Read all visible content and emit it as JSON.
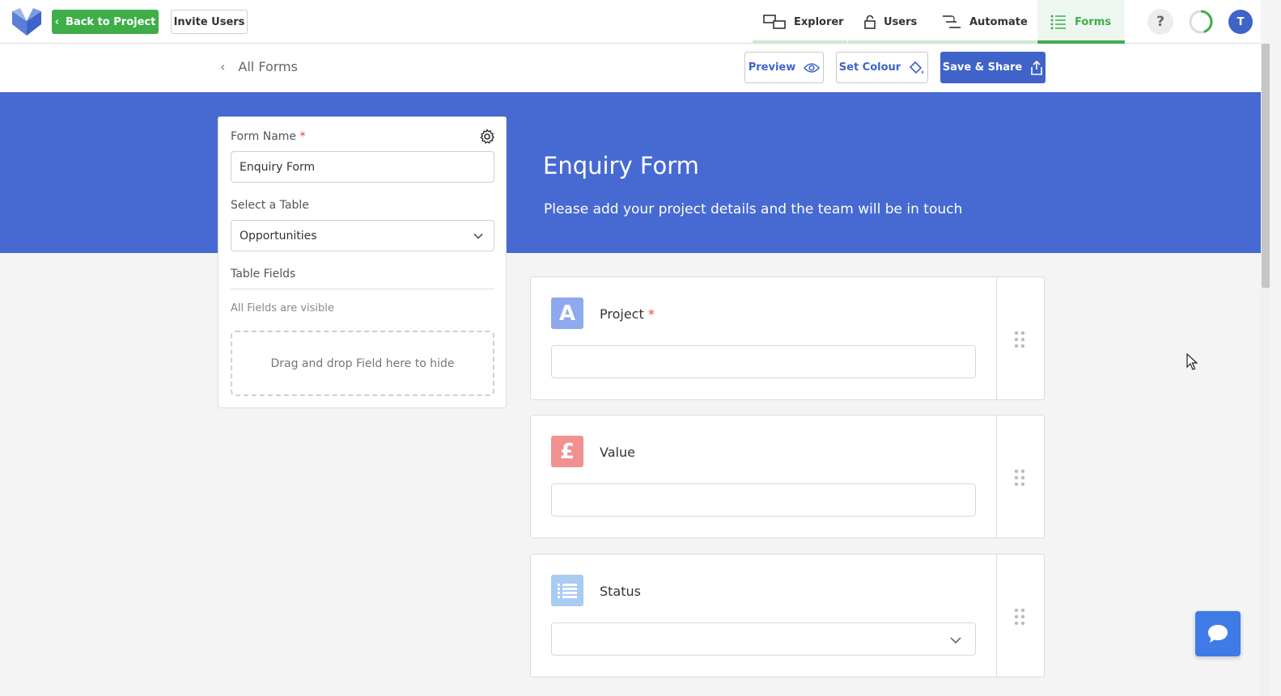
{
  "topnav": {
    "back_label": "Back to Project",
    "invite_label": "Invite Users",
    "tabs": [
      {
        "label": "Explorer",
        "icon": "explorer-icon"
      },
      {
        "label": "Users",
        "icon": "lock-icon"
      },
      {
        "label": "Automate",
        "icon": "automate-icon"
      },
      {
        "label": "Forms",
        "icon": "forms-icon",
        "active": true
      }
    ],
    "help_label": "?",
    "avatar_initial": "T"
  },
  "subheader": {
    "all_forms_label": "All Forms",
    "preview_label": "Preview",
    "set_colour_label": "Set Colour",
    "save_share_label": "Save & Share"
  },
  "banner": {
    "title": "Enquiry Form",
    "description": "Please add your project details and the team will be in touch",
    "color": "#476ad2"
  },
  "panel": {
    "form_name_label": "Form Name",
    "required_mark": "*",
    "form_name_value": "Enquiry Form",
    "select_table_label": "Select a Table",
    "select_table_value": "Opportunities",
    "table_fields_label": "Table Fields",
    "visible_note": "All Fields are visible",
    "dropzone_text": "Drag and drop Field here to hide"
  },
  "fields": [
    {
      "label": "Project",
      "required_mark": "*",
      "icon_glyph": "A",
      "icon_color": "#8fa9ee",
      "icon": "text-field-icon",
      "type": "text"
    },
    {
      "label": "Value",
      "required_mark": "",
      "icon_glyph": "£",
      "icon_color": "#f19191",
      "icon": "currency-field-icon",
      "type": "text"
    },
    {
      "label": "Status",
      "required_mark": "",
      "icon_glyph": "",
      "icon_color": "#a9ccf2",
      "icon": "list-field-icon",
      "type": "select"
    }
  ],
  "colors": {
    "accent_green": "#3fae49",
    "accent_blue": "#3f63c9",
    "required_red": "#e03c3c"
  }
}
